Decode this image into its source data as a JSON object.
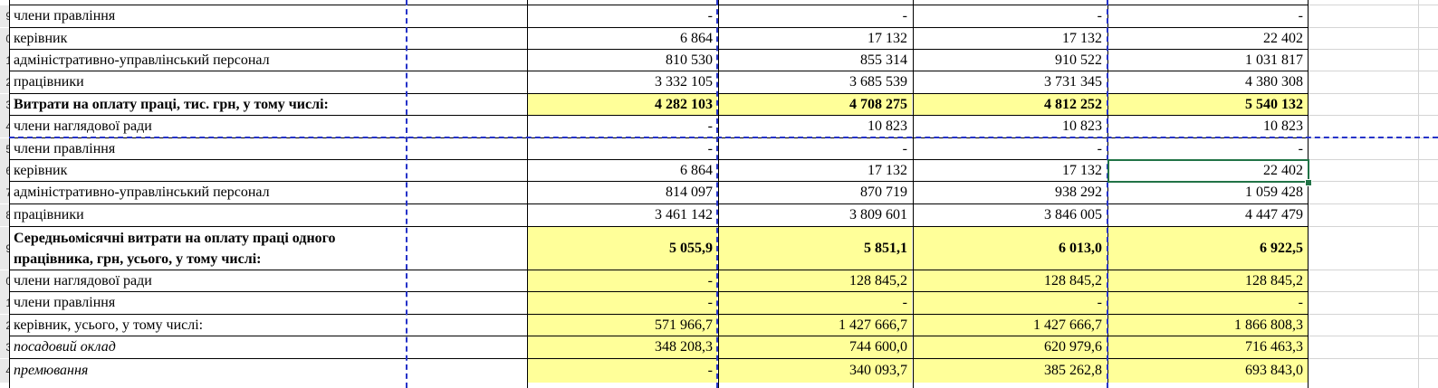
{
  "rows": [
    {
      "num": "9",
      "label": "члени правління",
      "v": [
        "-",
        "-",
        "-",
        "-"
      ],
      "style": "normal"
    },
    {
      "num": "0",
      "label": "керівник",
      "v": [
        "6 864",
        "17 132",
        "17 132",
        "22 402"
      ],
      "style": "normal"
    },
    {
      "num": "1",
      "label": "адміністративно-управлінський персонал",
      "v": [
        "810 530",
        "855 314",
        "910 522",
        "1 031 817"
      ],
      "style": "normal"
    },
    {
      "num": "2",
      "label": "працівники",
      "v": [
        "3 332 105",
        "3 685 539",
        "3 731 345",
        "4 380 308"
      ],
      "style": "normal"
    },
    {
      "num": "3",
      "label": "Витрати на оплату праці, тис. грн, у тому числі:",
      "v": [
        "4 282 103",
        "4 708 275",
        "4 812 252",
        "5 540 132"
      ],
      "style": "bold-hl"
    },
    {
      "num": "4",
      "label": "члени наглядової ради",
      "v": [
        "-",
        "10 823",
        "10 823",
        "10 823"
      ],
      "style": "normal"
    },
    {
      "num": "5",
      "label": "члени правління",
      "v": [
        "-",
        "-",
        "-",
        "-"
      ],
      "style": "normal"
    },
    {
      "num": "6",
      "label": "керівник",
      "v": [
        "6 864",
        "17 132",
        "17 132",
        "22 402"
      ],
      "style": "normal"
    },
    {
      "num": "7",
      "label": "адміністративно-управлінський персонал",
      "v": [
        "814 097",
        "870 719",
        "938 292",
        "1 059 428"
      ],
      "style": "normal"
    },
    {
      "num": "8",
      "label": "працівники",
      "v": [
        "3 461 142",
        "3 809 601",
        "3 846 005",
        "4 447 479"
      ],
      "style": "normal"
    },
    {
      "num": "9",
      "label": "Середньомісячні витрати на оплату праці одного працівника, грн, усього, у тому числі:",
      "v": [
        "5 055,9",
        "5 851,1",
        "6 013,0",
        "6 922,5"
      ],
      "style": "bold-hl-tall"
    },
    {
      "num": "0",
      "label": "члени наглядової ради",
      "v": [
        "-",
        "128 845,2",
        "128 845,2",
        "128 845,2"
      ],
      "style": "hl"
    },
    {
      "num": "1",
      "label": "члени правління",
      "v": [
        "-",
        "-",
        "-",
        "-"
      ],
      "style": "hl"
    },
    {
      "num": "2",
      "label": "керівник, усього, у тому числі:",
      "v": [
        "571 966,7",
        "1 427 666,7",
        "1 427 666,7",
        "1 866 808,3"
      ],
      "style": "hl"
    },
    {
      "num": "3",
      "label": "посадовий оклад",
      "v": [
        "348 208,3",
        "744 600,0",
        "620 979,6",
        "716 463,3"
      ],
      "style": "hl-ital"
    },
    {
      "num": "4",
      "label": "премювання",
      "v": [
        "-",
        "340 093,7",
        "385 262,8",
        "693 843,0"
      ],
      "style": "hl-ital"
    }
  ]
}
